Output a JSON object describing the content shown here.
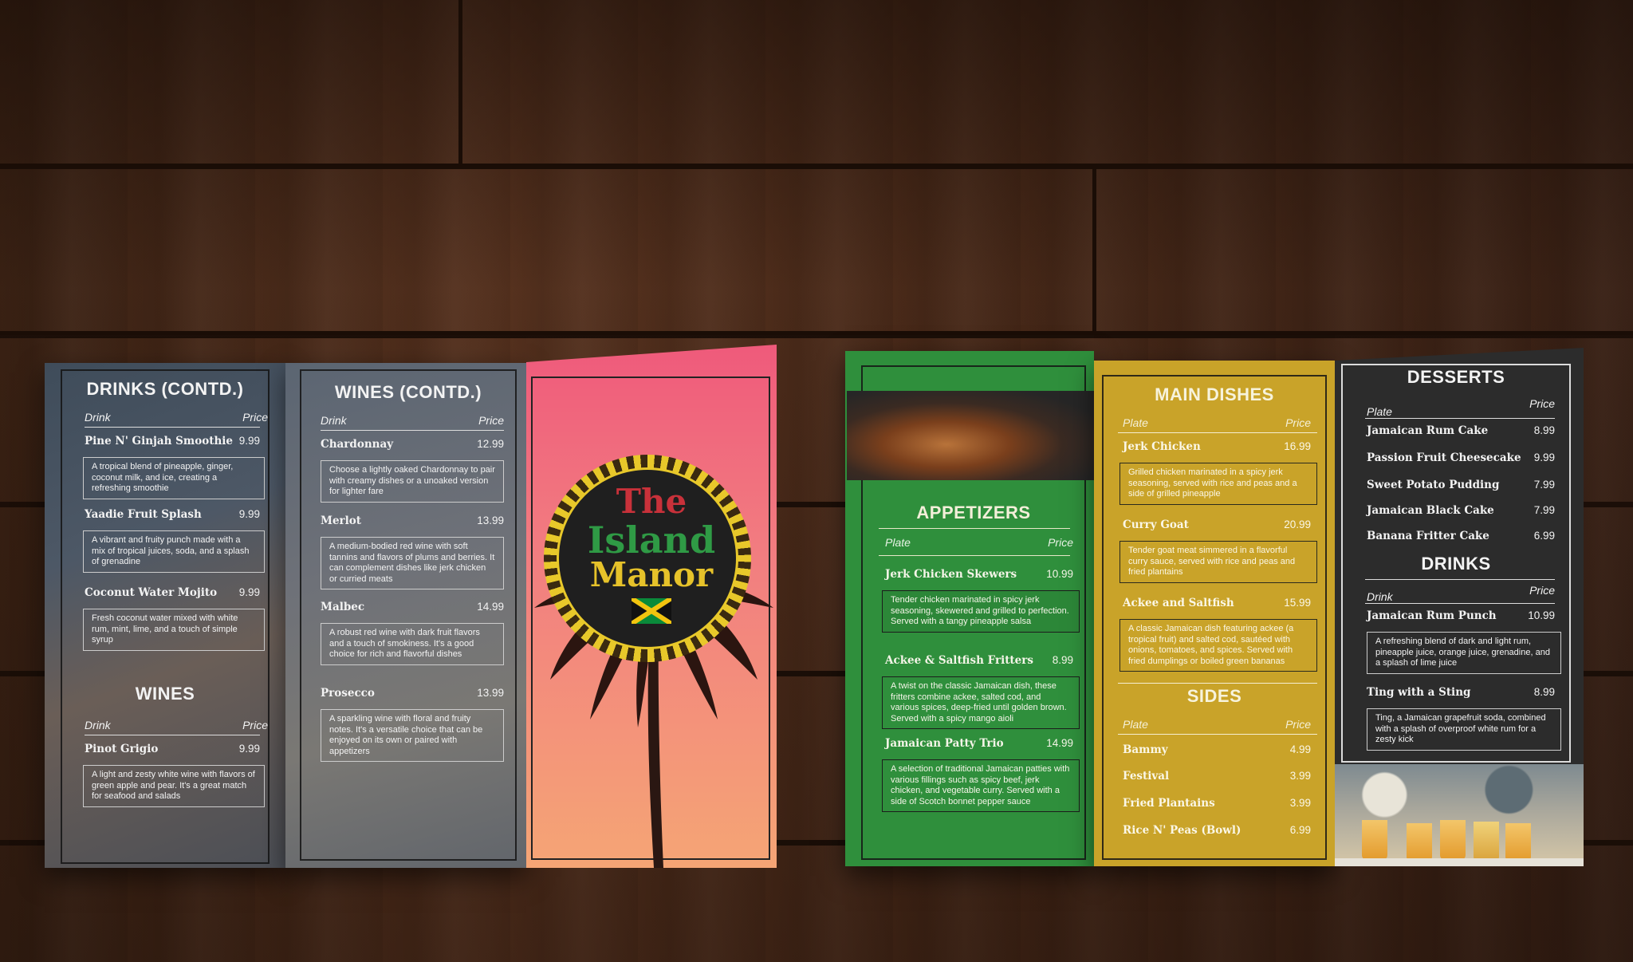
{
  "colors": {
    "green": "#2f8f3c",
    "gold": "#c9a329",
    "black": "#2c2c2c",
    "pink": "#ee5c76",
    "peach": "#f5a070"
  },
  "left": {
    "drinks_contd": {
      "title": "DRINKS (CONTD.)",
      "col1": "Drink",
      "col2": "Price",
      "items": [
        {
          "name": "Pine N' Ginjah Smoothie",
          "price": "9.99",
          "desc": "A tropical blend of pineapple, ginger, coconut milk, and ice, creating a refreshing smoothie"
        },
        {
          "name": "Yaadie Fruit Splash",
          "price": "9.99",
          "desc": "A vibrant and fruity punch made with a mix of tropical juices, soda, and a splash of grenadine"
        },
        {
          "name": "Coconut Water Mojito",
          "price": "9.99",
          "desc": "Fresh coconut water mixed with white rum, mint, lime, and a touch of simple syrup"
        }
      ]
    },
    "wines": {
      "title": "WINES",
      "col1": "Drink",
      "col2": "Price",
      "items": [
        {
          "name": "Pinot Grigio",
          "price": "9.99",
          "desc": "A light and zesty white wine with flavors of green apple and pear. It's a great match for seafood and salads"
        }
      ]
    },
    "wines_contd": {
      "title": "WINES (CONTD.)",
      "col1": "Drink",
      "col2": "Price",
      "items": [
        {
          "name": "Chardonnay",
          "price": "12.99",
          "desc": "Choose a lightly oaked Chardonnay to pair with creamy dishes or a unoaked version for lighter fare"
        },
        {
          "name": "Merlot",
          "price": "13.99",
          "desc": "A medium-bodied red wine with soft tannins and flavors of plums and berries. It can complement dishes like jerk chicken or curried meats"
        },
        {
          "name": "Malbec",
          "price": "14.99",
          "desc": "A robust red wine with dark fruit flavors and a touch of smokiness. It's a good choice for rich and flavorful dishes"
        },
        {
          "name": "Prosecco",
          "price": "13.99",
          "desc": "A sparkling wine with floral and fruity notes. It's a versatile choice that can be enjoyed on its own or paired with appetizers"
        }
      ]
    },
    "cover": {
      "line1": "The",
      "line2": "Island",
      "line3": "Manor"
    }
  },
  "right": {
    "appetizers": {
      "title": "APPETIZERS",
      "col1": "Plate",
      "col2": "Price",
      "items": [
        {
          "name": "Jerk Chicken Skewers",
          "price": "10.99",
          "desc": "Tender chicken marinated in spicy jerk seasoning, skewered and grilled to perfection. Served with a tangy pineapple salsa"
        },
        {
          "name": "Ackee & Saltfish Fritters",
          "price": "8.99",
          "desc": "A twist on the classic Jamaican dish, these fritters combine ackee, salted cod, and various spices, deep-fried until golden brown. Served with a spicy mango aioli"
        },
        {
          "name": "Jamaican Patty Trio",
          "price": "14.99",
          "desc": "A selection of traditional Jamaican patties with various fillings such as spicy beef, jerk chicken, and vegetable curry. Served with a side of Scotch bonnet pepper sauce"
        }
      ]
    },
    "mains": {
      "title": "MAIN DISHES",
      "col1": "Plate",
      "col2": "Price",
      "items": [
        {
          "name": "Jerk Chicken",
          "price": "16.99",
          "desc": "Grilled chicken marinated in a spicy jerk seasoning, served with rice and peas and a side of grilled pineapple"
        },
        {
          "name": "Curry Goat",
          "price": "20.99",
          "desc": "Tender goat meat simmered in a flavorful curry sauce, served with rice and peas and fried plantains"
        },
        {
          "name": "Ackee and Saltfish",
          "price": "15.99",
          "desc": "A classic Jamaican dish featuring ackee (a tropical fruit) and salted cod, sautéed with onions, tomatoes, and spices. Served with fried dumplings or boiled green bananas"
        }
      ]
    },
    "sides": {
      "title": "SIDES",
      "col1": "Plate",
      "col2": "Price",
      "items": [
        {
          "name": "Bammy",
          "price": "4.99"
        },
        {
          "name": "Festival",
          "price": "3.99"
        },
        {
          "name": "Fried Plantains",
          "price": "3.99"
        },
        {
          "name": "Rice N' Peas (Bowl)",
          "price": "6.99"
        }
      ]
    },
    "desserts": {
      "title": "DESSERTS",
      "col1": "Plate",
      "col2": "Price",
      "items": [
        {
          "name": "Jamaican Rum Cake",
          "price": "8.99"
        },
        {
          "name": "Passion Fruit Cheesecake",
          "price": "9.99"
        },
        {
          "name": "Sweet Potato Pudding",
          "price": "7.99"
        },
        {
          "name": "Jamaican Black Cake",
          "price": "7.99"
        },
        {
          "name": "Banana Fritter Cake",
          "price": "6.99"
        }
      ]
    },
    "drinks": {
      "title": "DRINKS",
      "col1": "Drink",
      "col2": "Price",
      "items": [
        {
          "name": "Jamaican Rum Punch",
          "price": "10.99",
          "desc": "A refreshing blend of dark and light rum, pineapple juice, orange juice, grenadine, and a splash of lime juice"
        },
        {
          "name": "Ting with a Sting",
          "price": "8.99",
          "desc": "Ting, a Jamaican grapefruit soda, combined with a splash of overproof white rum for a zesty kick"
        }
      ]
    }
  }
}
